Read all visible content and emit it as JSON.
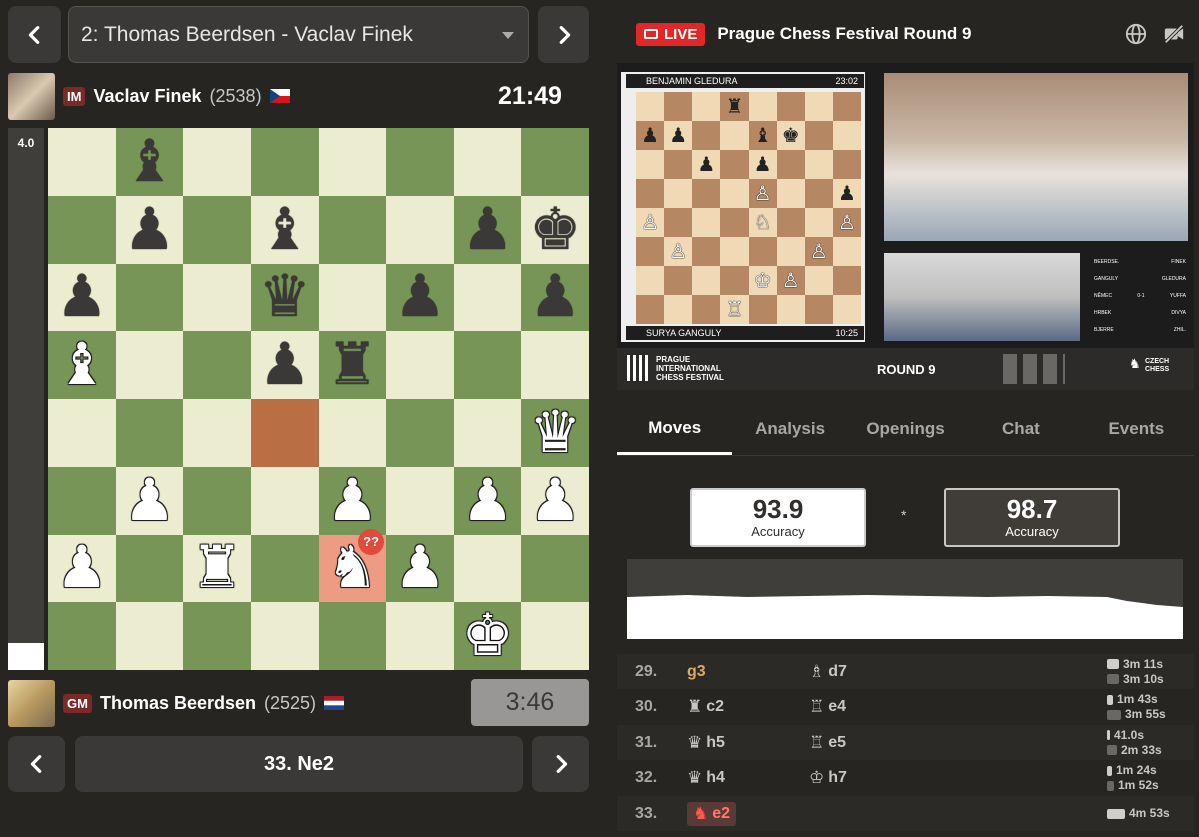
{
  "nav": {
    "game_select": "2: Thomas Beerdsen - Vaclav Finek",
    "prev_game_icon": "chevron-left-icon",
    "next_game_icon": "chevron-right-icon"
  },
  "top_player": {
    "title": "IM",
    "name": "Vaclav Finek",
    "rating": "(2538)",
    "flag": "CZ",
    "clock": "21:49"
  },
  "bottom_player": {
    "title": "GM",
    "name": "Thomas Beerdsen",
    "rating": "(2525)",
    "flag": "NL",
    "clock": "3:46"
  },
  "eval": {
    "text": "4.0",
    "white_fraction": 0.05
  },
  "board": {
    "ranks": [
      [
        "",
        "bB",
        "",
        "",
        "",
        "",
        "",
        ""
      ],
      [
        "",
        "bP",
        "",
        "bB",
        "",
        "",
        "bP",
        "bK"
      ],
      [
        "bP",
        "",
        "",
        "bQ",
        "",
        "bP",
        "",
        "bP"
      ],
      [
        "wB",
        "",
        "",
        "bP",
        "bR",
        "",
        "",
        ""
      ],
      [
        "",
        "",
        "",
        "",
        "",
        "",
        "",
        "wQ"
      ],
      [
        "",
        "wP",
        "",
        "",
        "wP",
        "",
        "wP",
        "wP"
      ],
      [
        "wP",
        "",
        "wR",
        "",
        "wN",
        "wP",
        "",
        ""
      ],
      [
        "",
        "",
        "",
        "",
        "",
        "",
        "wK",
        ""
      ]
    ],
    "highlight_from": [
      4,
      3
    ],
    "highlight_to": [
      6,
      4
    ],
    "blunder_mark": "??"
  },
  "move_nav": {
    "current_move": "33. Ne2"
  },
  "stream": {
    "live_label": "LIVE",
    "title": "Prague Chess Festival Round 9",
    "globe_icon": "globe-icon",
    "camera_off_icon": "camera-off-icon",
    "overlay_top_player": "BENJAMIN GLEDURA",
    "overlay_top_time": "23:02",
    "overlay_bottom_player": "SURYA GANGULY",
    "overlay_bottom_time": "10:25",
    "festival_name_1": "PRAGUE",
    "festival_name_2": "INTERNATIONAL",
    "festival_name_3": "CHESS FESTIVAL",
    "round_label": "ROUND 9",
    "federation_1": "CZECH",
    "federation_2": "CHESS",
    "standings": [
      {
        "left": "BEERDSE.",
        "right": "FINEK"
      },
      {
        "left": "GANGULY",
        "right": "GLEDURA"
      },
      {
        "left": "NĚMEC",
        "mid": "0-1",
        "right": "YUFFA"
      },
      {
        "left": "HRBEK",
        "right": "DIVYA"
      },
      {
        "left": "BJERRE",
        "right": "ZHIL."
      }
    ]
  },
  "tabs": [
    {
      "label": "Moves",
      "active": true
    },
    {
      "label": "Analysis",
      "active": false
    },
    {
      "label": "Openings",
      "active": false
    },
    {
      "label": "Chat",
      "active": false
    },
    {
      "label": "Events",
      "active": false
    }
  ],
  "accuracy": {
    "white_value": "93.9",
    "white_label": "Accuracy",
    "black_value": "98.7",
    "black_label": "Accuracy",
    "separator": "*"
  },
  "moves": [
    {
      "num": "29.",
      "white": "g3",
      "white_piece": "",
      "black": "d7",
      "black_piece": "♗",
      "w_time": "3m 11s",
      "b_time": "3m 10s",
      "w_bar": 12,
      "b_bar": 12,
      "style": "best"
    },
    {
      "num": "30.",
      "white": "c2",
      "white_piece": "♜",
      "black": "e4",
      "black_piece": "♖",
      "w_time": "1m 43s",
      "b_time": "3m 55s",
      "w_bar": 6,
      "b_bar": 14,
      "style": ""
    },
    {
      "num": "31.",
      "white": "h5",
      "white_piece": "♛",
      "black": "e5",
      "black_piece": "♖",
      "w_time": "41.0s",
      "b_time": "2m 33s",
      "w_bar": 3,
      "b_bar": 10,
      "style": ""
    },
    {
      "num": "32.",
      "white": "h4",
      "white_piece": "♛",
      "black": "h7",
      "black_piece": "♔",
      "w_time": "1m 24s",
      "b_time": "1m 52s",
      "w_bar": 5,
      "b_bar": 7,
      "style": ""
    },
    {
      "num": "33.",
      "white": "e2",
      "white_piece": "♞",
      "black": "",
      "black_piece": "",
      "w_time": "4m 53s",
      "b_time": "",
      "w_bar": 18,
      "b_bar": 0,
      "style": "current"
    }
  ]
}
